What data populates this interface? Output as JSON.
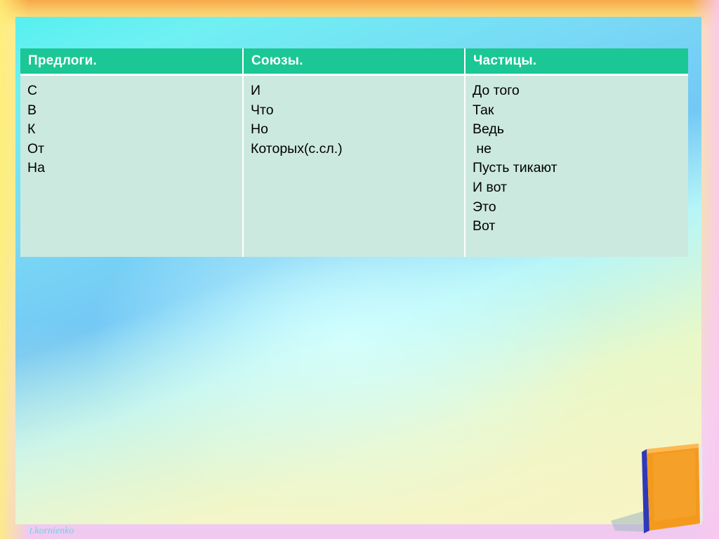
{
  "table": {
    "headers": [
      "Предлоги.",
      "Союзы.",
      "Частицы."
    ],
    "columns": [
      [
        "С",
        "В",
        "К",
        "От",
        "На"
      ],
      [
        "И",
        "Что",
        "Но",
        "Которых(с.сл.)"
      ],
      [
        "До того",
        "Так",
        "Ведь",
        " не",
        "Пусть тикают",
        "И вот",
        "Это",
        "Вот"
      ]
    ]
  },
  "watermark": "t.kornienko",
  "colors": {
    "header_bg": "#1bc794",
    "cell_bg": "#cce9e0",
    "header_text": "#ffffff",
    "book_cover": "#f39a1e"
  },
  "decorations": {
    "book": "book-icon"
  }
}
